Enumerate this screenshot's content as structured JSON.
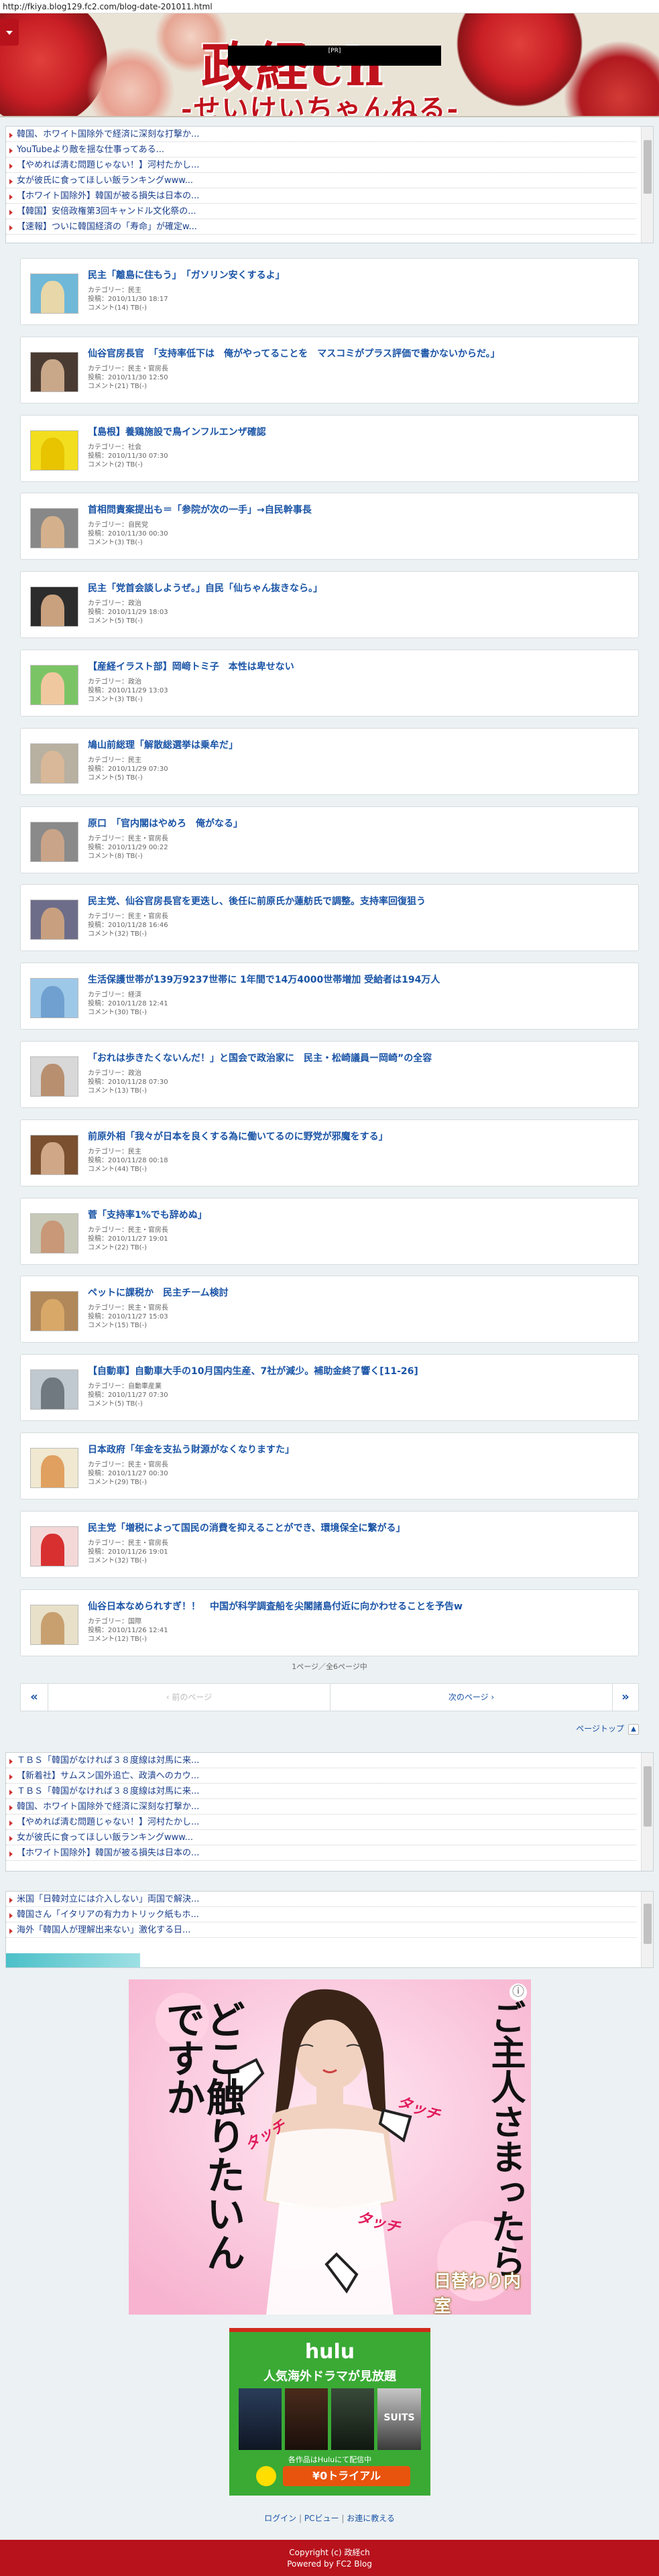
{
  "browser": {
    "url": "http://fkiya.blog129.fc2.com/blog-date-201011.html"
  },
  "header": {
    "title": "政経ch",
    "subtitle": "-せいけいちゃんねる-",
    "black_bar_text": "[PR]"
  },
  "ticker_top": [
    "韓国、ホワイト国除外で経済に深刻な打撃か...",
    "YouTubeより敵を揺な仕事ってある...",
    "【やめれば清む問題じゃない！】河村たかし...",
    "女が彼氏に食ってほしい飯ランキングwww...",
    "【ホワイト国除外】韓国が被る損失は日本の...",
    "【韓国】安倍政権第3回キャンドル文化祭の...",
    "【速報】ついに韓国経済の「寿命」が確定w..."
  ],
  "articles": [
    {
      "title": "民主「離島に住もう」　「ガソリン安くするよ」",
      "category": "カテゴリー：民主",
      "posted": "投稿：2010/11/30 18:17",
      "comments": "コメント(14)  TB(-)",
      "c1": "#6fb8d8",
      "c2": "#e8d7a8"
    },
    {
      "title": "仙谷官房長官　「支持率低下は　俺がやってることを　マスコミがプラス評価で書かないからだ。」",
      "category": "カテゴリー：民主・官房長",
      "posted": "投稿：2010/11/30 12:50",
      "comments": "コメント(21)  TB(-)",
      "c1": "#4a3b32",
      "c2": "#c9a88a"
    },
    {
      "title": "【島根】養鶏施設で鳥インフルエンザ確認",
      "category": "カテゴリー：社会",
      "posted": "投稿：2010/11/30 07:30",
      "comments": "コメント(2)  TB(-)",
      "c1": "#f2de1e",
      "c2": "#e7c300"
    },
    {
      "title": "首相問責案提出も＝「参院が次の一手」→自民幹事長",
      "category": "カテゴリー：自民党",
      "posted": "投稿：2010/11/30 00:30",
      "comments": "コメント(3)  TB(-)",
      "c1": "#888888",
      "c2": "#d4b08c"
    },
    {
      "title": "民主「党首会談しようぜ。」自民「仙ちゃん抜きなら。」",
      "category": "カテゴリー：政治",
      "posted": "投稿：2010/11/29 18:03",
      "comments": "コメント(5)  TB(-)",
      "c1": "#2c2c2c",
      "c2": "#caa17e"
    },
    {
      "title": "【産経イラスト部】岡﨑トミ子　本性は卑せない",
      "category": "カテゴリー：政治",
      "posted": "投稿：2010/11/29 13:03",
      "comments": "コメント(3)  TB(-)",
      "c1": "#7bc466",
      "c2": "#f0c8a0"
    },
    {
      "title": "鳩山前総理「解散総選挙は乗牟だ」",
      "category": "カテゴリー：民主",
      "posted": "投稿：2010/11/29 07:30",
      "comments": "コメント(5)  TB(-)",
      "c1": "#b8b0a0",
      "c2": "#d8b898"
    },
    {
      "title": "原口　「官内閣はやめろ　俺がなる」",
      "category": "カテゴリー：民主・官房長",
      "posted": "投稿：2010/11/29 00:22",
      "comments": "コメント(8)  TB(-)",
      "c1": "#8a8a8a",
      "c2": "#caa488"
    },
    {
      "title": "民主党、仙谷官房長官を更迭し、後任に前原氏か蓮舫氏で調整。支持率回復狙う",
      "category": "カテゴリー：民主・官房長",
      "posted": "投稿：2010/11/28 16:46",
      "comments": "コメント(32)  TB(-)",
      "c1": "#6d6d8a",
      "c2": "#c8a080"
    },
    {
      "title": "生活保護世帯が139万9237世帯に 1年間で14万4000世帯増加 受給者は194万人",
      "category": "カテゴリー：経済",
      "posted": "投稿：2010/11/28 12:41",
      "comments": "コメント(30)  TB(-)",
      "c1": "#9ec8e8",
      "c2": "#6fa0d0"
    },
    {
      "title": "「おれは歩きたくないんだ！」と国会で政治家に　民主・松崎議員ー岡崎”の全容",
      "category": "カテゴリー：政治",
      "posted": "投稿：2010/11/28 07:30",
      "comments": "コメント(13)  TB(-)",
      "c1": "#d8d8d8",
      "c2": "#b89070"
    },
    {
      "title": "前原外相「我々が日本を良くする為に働いてるのに野党が邪魔をする」",
      "category": "カテゴリー：民主",
      "posted": "投稿：2010/11/28 00:18",
      "comments": "コメント(44)  TB(-)",
      "c1": "#7a5030",
      "c2": "#d0a888"
    },
    {
      "title": "菅「支持率1%でも辞めぬ」",
      "category": "カテゴリー：民主・官房長",
      "posted": "投稿：2010/11/27 19:01",
      "comments": "コメント(22)  TB(-)",
      "c1": "#c8c8b8",
      "c2": "#c89878"
    },
    {
      "title": "ペットに課税か　民主チーム検討",
      "category": "カテゴリー：民主・官房長",
      "posted": "投稿：2010/11/27 15:03",
      "comments": "コメント(15)  TB(-)",
      "c1": "#b0885a",
      "c2": "#d8a868"
    },
    {
      "title": "【自動車】自動車大手の10月国内生産、7社が減少。補助金終了響く[11-26]",
      "category": "カテゴリー：自動車産業",
      "posted": "投稿：2010/11/27 07:30",
      "comments": "コメント(5)  TB(-)",
      "c1": "#c0c8d0",
      "c2": "#707880"
    },
    {
      "title": "日本政府「年金を支払う財源がなくなりますた」",
      "category": "カテゴリー：民主・官房長",
      "posted": "投稿：2010/11/27 00:30",
      "comments": "コメント(29)  TB(-)",
      "c1": "#f0e8d0",
      "c2": "#e0a060"
    },
    {
      "title": "民主党「増税によって国民の消費を抑えることができ、環境保全に繋がる」",
      "category": "カテゴリー：民主・官房長",
      "posted": "投稿：2010/11/26 19:01",
      "comments": "コメント(32)  TB(-)",
      "c1": "#f4d8d8",
      "c2": "#d83030"
    },
    {
      "title": "仙谷日本なめられすぎ！！　中国が科学調査船を尖閣諸島付近に向かわせることを予告w",
      "category": "カテゴリー：国際",
      "posted": "投稿：2010/11/26 12:41",
      "comments": "コメント(12)  TB(-)",
      "c1": "#e8e0c8",
      "c2": "#c8a070"
    }
  ],
  "pagination": {
    "info": "1ページ／全6ページ中",
    "first_label": "«",
    "prev_label": "‹ 前のページ",
    "next_label": "次のページ ›",
    "last_label": "»"
  },
  "page_top_label": "ページトップ",
  "ticker_bottom1": [
    "ＴＢＳ「韓国がなければ３８度線は対馬に来...",
    "【新着社】サムスン国外追亡、政潰へのカウ...",
    "ＴＢＳ「韓国がなければ３８度線は対馬に来...",
    "韓国、ホワイト国除外で経済に深刻な打撃か...",
    "【やめれば清む問題じゃない！】河村たかし...",
    "女が彼氏に食ってほしい飯ランキングwww...",
    "【ホワイト国除外】韓国が被る損失は日本の..."
  ],
  "ticker_bottom2": [
    "米国「日韓対立には介入しない」両国で解決...",
    "韓国さん「イタリアの有力カトリック紙もホ...",
    "海外「韓国人が理解出来ない」激化する日..."
  ],
  "ad1": {
    "info_icon": "ⓘ",
    "text_left": "どこ触りたいんですか",
    "text_right": "ご主人さまったら",
    "touch1": "タッチ",
    "touch2": "タッチ",
    "touch3": "タッチ",
    "logo": "日替わり内室"
  },
  "ad2": {
    "brand": "hulu",
    "headline": "人気海外ドラマが見放題",
    "sub": "各作品はHuluにて配信中",
    "cta": "¥0トライアル",
    "show": "SUITS"
  },
  "footer": {
    "links": [
      "ログイン",
      "PCビュー",
      "お連に教える"
    ],
    "sep": "|",
    "copyright": "Copyright (c) 政経ch",
    "powered": "Powered by FC2 Blog"
  }
}
